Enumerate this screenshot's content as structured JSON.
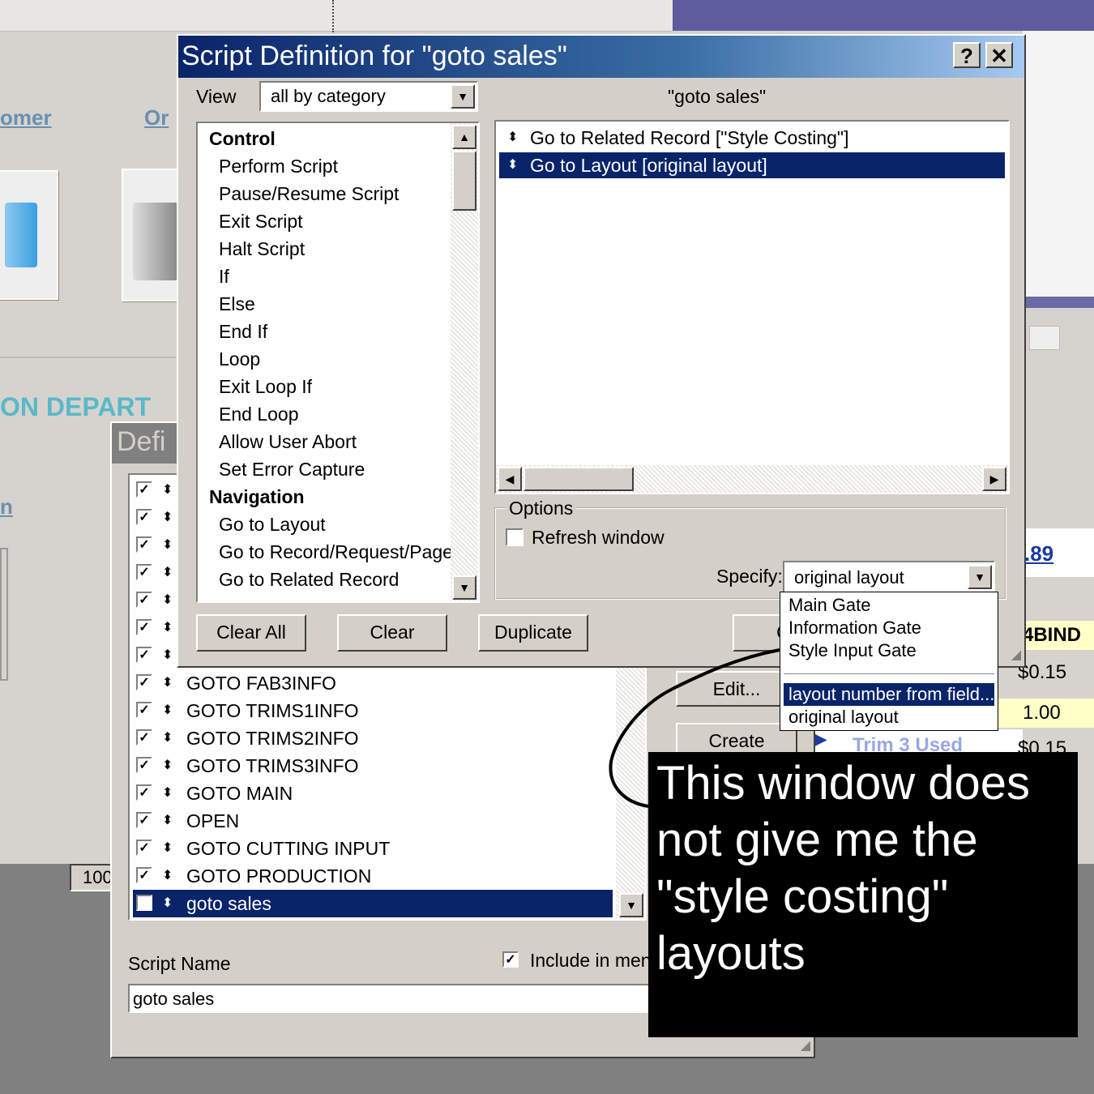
{
  "background": {
    "link_customer": "omer",
    "link_or": "Or",
    "dept": "ON DEPART",
    "link_n": "n",
    "price_89": ".89",
    "bind_label": "4BIND",
    "price_1": "$0.15",
    "price_2": "1.00",
    "price_3": "$0.15",
    "trim_label": "Trim 3 Used",
    "hundred": "100"
  },
  "def_window": {
    "title": "Defi",
    "scripts": [
      {
        "name": "GOTO FAB3INFO",
        "checked": true
      },
      {
        "name": "GOTO TRIMS1INFO",
        "checked": true
      },
      {
        "name": "GOTO TRIMS2INFO",
        "checked": true
      },
      {
        "name": "GOTO TRIMS3INFO",
        "checked": true
      },
      {
        "name": "GOTO MAIN",
        "checked": true
      },
      {
        "name": "OPEN",
        "checked": true
      },
      {
        "name": "GOTO CUTTING INPUT",
        "checked": true
      },
      {
        "name": "GOTO PRODUCTION",
        "checked": true
      },
      {
        "name": "goto sales",
        "checked": true,
        "selected": true
      }
    ],
    "edit_label": "Edit...",
    "create_label": "Create",
    "script_name_label": "Script Name",
    "script_name_value": "goto sales",
    "include_in_menu_label": "Include in menu"
  },
  "script_window": {
    "title": "Script Definition for \"goto sales\"",
    "help_label": "?",
    "close_label": "✕",
    "view_label": "View",
    "view_value": "all by category",
    "script_header": "\"goto sales\"",
    "steps_list": [
      {
        "type": "category",
        "label": "Control"
      },
      {
        "type": "step",
        "label": "Perform Script"
      },
      {
        "type": "step",
        "label": "Pause/Resume Script"
      },
      {
        "type": "step",
        "label": "Exit Script"
      },
      {
        "type": "step",
        "label": "Halt Script"
      },
      {
        "type": "step",
        "label": "If"
      },
      {
        "type": "step",
        "label": "Else"
      },
      {
        "type": "step",
        "label": "End If"
      },
      {
        "type": "step",
        "label": "Loop"
      },
      {
        "type": "step",
        "label": "Exit Loop If"
      },
      {
        "type": "step",
        "label": "End Loop"
      },
      {
        "type": "step",
        "label": "Allow User Abort"
      },
      {
        "type": "step",
        "label": "Set Error Capture"
      },
      {
        "type": "category",
        "label": "Navigation"
      },
      {
        "type": "step",
        "label": "Go to Layout"
      },
      {
        "type": "step",
        "label": "Go to Record/Request/Page"
      },
      {
        "type": "step",
        "label": "Go to Related Record"
      }
    ],
    "script_steps": [
      {
        "label": "Go to Related Record [\"Style Costing\"]",
        "selected": false
      },
      {
        "label": "Go to Layout [original layout]",
        "selected": true
      }
    ],
    "options_label": "Options",
    "refresh_label": "Refresh window",
    "specify_label": "Specify:",
    "specify_value": "original layout",
    "layout_options": [
      {
        "label": "Main Gate",
        "selected": false
      },
      {
        "label": "Information Gate",
        "selected": false
      },
      {
        "label": "Style Input Gate",
        "selected": false
      },
      {
        "label": "",
        "selected": false
      },
      {
        "label": "layout number from field...",
        "selected": true
      },
      {
        "label": "original layout",
        "selected": false
      }
    ],
    "clear_all_label": "Clear All",
    "clear_label": "Clear",
    "duplicate_label": "Duplicate",
    "ok_partial_label": "O"
  },
  "annotation": {
    "text": "This window does\nnot give me the\n\"style costing\"\nlayouts"
  }
}
